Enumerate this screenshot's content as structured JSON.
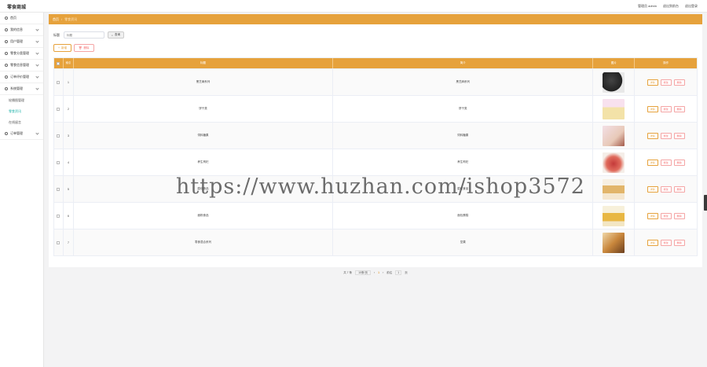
{
  "app": {
    "brand": "零食商城"
  },
  "header": {
    "user_label": "管理员 admin",
    "front_link": "退出到前台",
    "logout": "退出登录"
  },
  "sidebar": {
    "items": [
      {
        "label": "首页"
      },
      {
        "label": "我的信息"
      },
      {
        "label": "用户管理"
      },
      {
        "label": "零食分类管理"
      },
      {
        "label": "零食信息管理"
      },
      {
        "label": "订单评价管理"
      },
      {
        "label": "系统管理"
      }
    ],
    "subitems": [
      {
        "label": "轮播图管理"
      },
      {
        "label": "零食资讯"
      },
      {
        "label": "在线留言"
      }
    ],
    "last_item": {
      "label": "订单管理"
    }
  },
  "breadcrumb": {
    "home": "首页",
    "sep": "/",
    "current": "零食资讯"
  },
  "search": {
    "label": "标题",
    "placeholder": "标题",
    "button": "查询"
  },
  "toolbar": {
    "add": "新增",
    "delete": "删除"
  },
  "table": {
    "headers": {
      "no": "索引",
      "name": "标题",
      "cat": "简介",
      "img": "图片",
      "op": "操作"
    },
    "rows": [
      {
        "no": "1",
        "name": "黑芝麻系列",
        "cat": "黑芝麻系列"
      },
      {
        "no": "2",
        "name": "饼干类",
        "cat": "饼干类"
      },
      {
        "no": "3",
        "name": "饲料糖果",
        "cat": "饲料糖果"
      },
      {
        "no": "4",
        "name": "养生枸杞",
        "cat": "养生枸杞"
      },
      {
        "no": "5",
        "name": "膨化食品",
        "cat": "膨化食品"
      },
      {
        "no": "6",
        "name": "面粉食品",
        "cat": "面包蛋糕"
      },
      {
        "no": "7",
        "name": "零食混合系列",
        "cat": "坚果"
      }
    ],
    "ops": {
      "view": "详情",
      "edit": "修改",
      "delete": "删除"
    }
  },
  "pagination": {
    "total": "共 7 条",
    "page_size": "10条/页",
    "current_page": "1",
    "goto_label": "前往",
    "goto_value": "1",
    "page_suffix": "页"
  },
  "watermark": "https://www.huzhan.com/ishop3572",
  "colors": {
    "accent": "#e6a23c",
    "danger": "#f56c6c",
    "active_menu": "#20b2aa"
  }
}
